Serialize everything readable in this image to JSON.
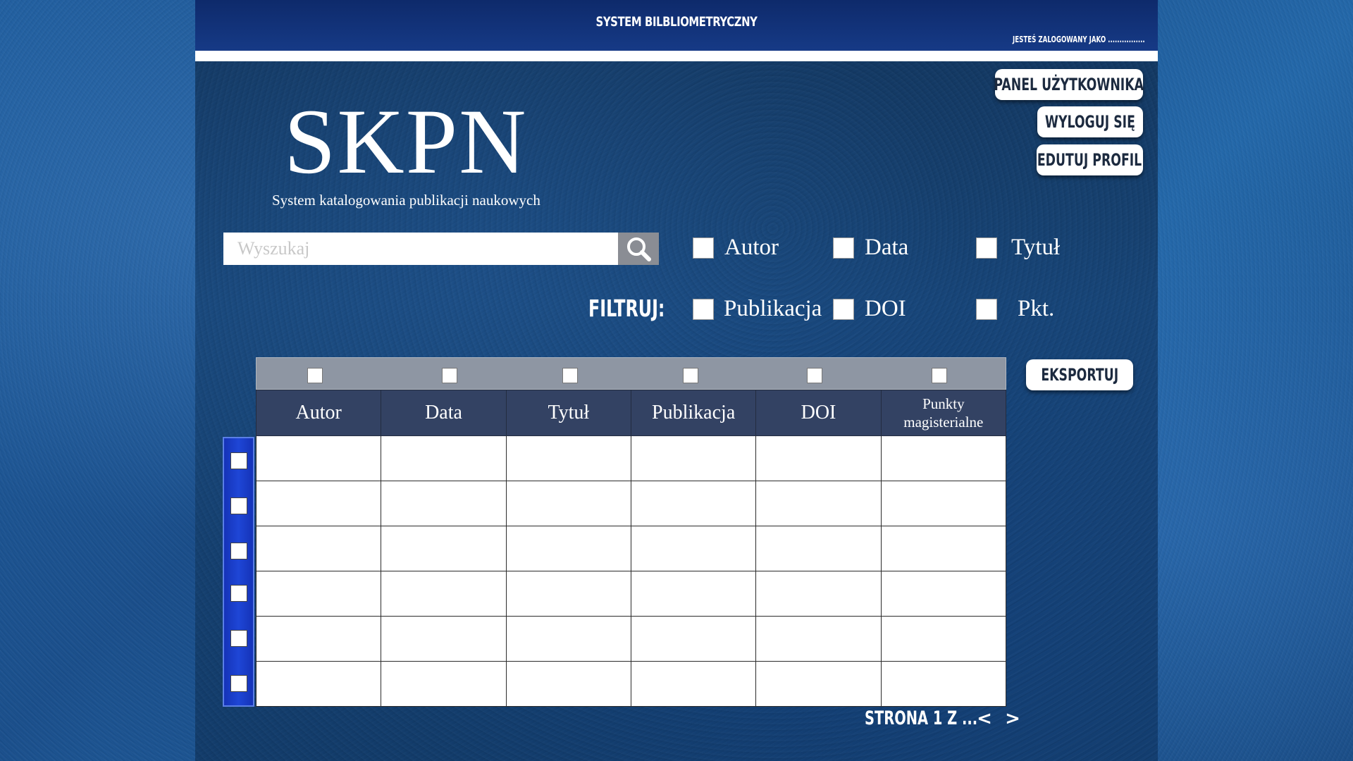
{
  "header": {
    "title": "SYSTEM BILBLIOMETRYCZNY",
    "logged_in": "JESTEŚ ZALOGOWANY JAKO ................"
  },
  "side_buttons": {
    "user_panel": "PANEL UŻYTKOWNIKA",
    "logout": "WYLOGUJ SIĘ",
    "edit_profile": "EDUTUJ PROFIL"
  },
  "branding": {
    "logo": "SKPN",
    "subtitle": "System katalogowania publikacji naukowych"
  },
  "search": {
    "placeholder": "Wyszukaj",
    "icon": "search-icon"
  },
  "filters": {
    "label": "FILTRUJ:",
    "options": [
      "Autor",
      "Data",
      "Tytuł",
      "Publikacja",
      "DOI",
      "Pkt."
    ]
  },
  "table": {
    "columns": [
      "Autor",
      "Data",
      "Tytuł",
      "Publikacja",
      "DOI",
      "Punkty magisterialne"
    ],
    "row_count": 6
  },
  "export": {
    "label": "EKSPORTUJ"
  },
  "pagination": {
    "label": "STRONA 1 Z ...",
    "prev": "<",
    "next": ">"
  },
  "colors": {
    "topbar": "#163a86",
    "table_header": "#334263",
    "row_check_bar": "#1e46d6"
  }
}
